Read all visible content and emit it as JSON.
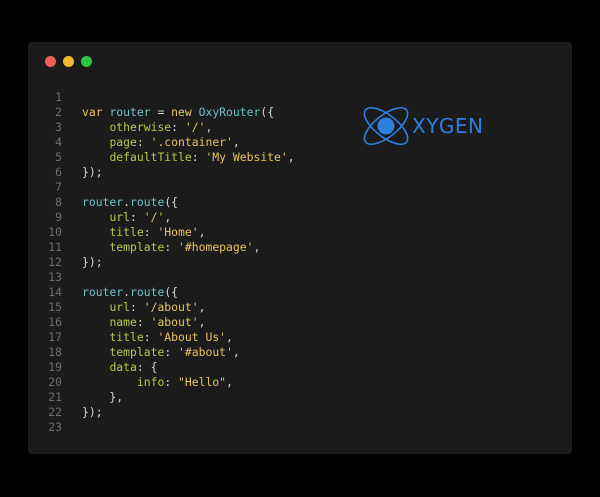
{
  "window": {
    "buttons": [
      {
        "name": "close",
        "color": "#ef5f57"
      },
      {
        "name": "minimize",
        "color": "#f2b92c"
      },
      {
        "name": "maximize",
        "color": "#28c840"
      }
    ]
  },
  "logo": {
    "text": "XYGEN",
    "icon": "atom-orbit-icon",
    "color": "#2d7fe0"
  },
  "code": {
    "lines": [
      {
        "n": "1",
        "tokens": []
      },
      {
        "n": "2",
        "tokens": [
          [
            "kw",
            "var "
          ],
          [
            "var",
            "router"
          ],
          [
            "punc",
            " = "
          ],
          [
            "kw",
            "new "
          ],
          [
            "cls",
            "OxyRouter"
          ],
          [
            "punc",
            "({"
          ]
        ]
      },
      {
        "n": "3",
        "tokens": [
          [
            "punc",
            "    "
          ],
          [
            "prop",
            "otherwise"
          ],
          [
            "punc",
            ": "
          ],
          [
            "str",
            "'/'"
          ],
          [
            "punc",
            ","
          ]
        ]
      },
      {
        "n": "4",
        "tokens": [
          [
            "punc",
            "    "
          ],
          [
            "prop",
            "page"
          ],
          [
            "punc",
            ": "
          ],
          [
            "str",
            "'.container'"
          ],
          [
            "punc",
            ","
          ]
        ]
      },
      {
        "n": "5",
        "tokens": [
          [
            "punc",
            "    "
          ],
          [
            "prop",
            "defaultTitle"
          ],
          [
            "punc",
            ": "
          ],
          [
            "str",
            "'My Website'"
          ],
          [
            "punc",
            ","
          ]
        ]
      },
      {
        "n": "6",
        "tokens": [
          [
            "punc",
            "});"
          ]
        ]
      },
      {
        "n": "7",
        "tokens": []
      },
      {
        "n": "8",
        "tokens": [
          [
            "var",
            "router"
          ],
          [
            "punc",
            "."
          ],
          [
            "var",
            "route"
          ],
          [
            "punc",
            "({"
          ]
        ]
      },
      {
        "n": "9",
        "tokens": [
          [
            "punc",
            "    "
          ],
          [
            "prop",
            "url"
          ],
          [
            "punc",
            ": "
          ],
          [
            "str",
            "'/'"
          ],
          [
            "punc",
            ","
          ]
        ]
      },
      {
        "n": "10",
        "tokens": [
          [
            "punc",
            "    "
          ],
          [
            "prop",
            "title"
          ],
          [
            "punc",
            ": "
          ],
          [
            "str",
            "'Home'"
          ],
          [
            "punc",
            ","
          ]
        ]
      },
      {
        "n": "11",
        "tokens": [
          [
            "punc",
            "    "
          ],
          [
            "prop",
            "template"
          ],
          [
            "punc",
            ": "
          ],
          [
            "str",
            "'#homepage'"
          ],
          [
            "punc",
            ","
          ]
        ]
      },
      {
        "n": "12",
        "tokens": [
          [
            "punc",
            "});"
          ]
        ]
      },
      {
        "n": "13",
        "tokens": []
      },
      {
        "n": "14",
        "tokens": [
          [
            "var",
            "router"
          ],
          [
            "punc",
            "."
          ],
          [
            "var",
            "route"
          ],
          [
            "punc",
            "({"
          ]
        ]
      },
      {
        "n": "15",
        "tokens": [
          [
            "punc",
            "    "
          ],
          [
            "prop",
            "url"
          ],
          [
            "punc",
            ": "
          ],
          [
            "str",
            "'/about'"
          ],
          [
            "punc",
            ","
          ]
        ]
      },
      {
        "n": "16",
        "tokens": [
          [
            "punc",
            "    "
          ],
          [
            "prop",
            "name"
          ],
          [
            "punc",
            ": "
          ],
          [
            "str",
            "'about'"
          ],
          [
            "punc",
            ","
          ]
        ]
      },
      {
        "n": "17",
        "tokens": [
          [
            "punc",
            "    "
          ],
          [
            "prop",
            "title"
          ],
          [
            "punc",
            ": "
          ],
          [
            "str",
            "'About Us'"
          ],
          [
            "punc",
            ","
          ]
        ]
      },
      {
        "n": "18",
        "tokens": [
          [
            "punc",
            "    "
          ],
          [
            "prop",
            "template"
          ],
          [
            "punc",
            ": "
          ],
          [
            "str",
            "'#about'"
          ],
          [
            "punc",
            ","
          ]
        ]
      },
      {
        "n": "19",
        "tokens": [
          [
            "punc",
            "    "
          ],
          [
            "prop",
            "data"
          ],
          [
            "punc",
            ": {"
          ]
        ]
      },
      {
        "n": "20",
        "tokens": [
          [
            "punc",
            "        "
          ],
          [
            "prop",
            "info"
          ],
          [
            "punc",
            ": "
          ],
          [
            "str",
            "\"Hello\""
          ],
          [
            "punc",
            ","
          ]
        ]
      },
      {
        "n": "21",
        "tokens": [
          [
            "punc",
            "    },"
          ]
        ]
      },
      {
        "n": "22",
        "tokens": [
          [
            "punc",
            "});"
          ]
        ]
      },
      {
        "n": "23",
        "tokens": []
      }
    ]
  }
}
